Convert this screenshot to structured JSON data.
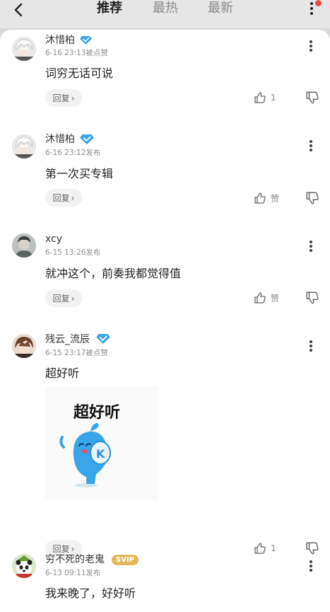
{
  "header": {
    "tabs": [
      {
        "label": "推荐",
        "active": true
      },
      {
        "label": "最热",
        "active": false
      },
      {
        "label": "最新",
        "active": false
      }
    ]
  },
  "colors": {
    "verified_badge": "#39a6f0",
    "svip_badge": "#e2b85a",
    "notification_dot": "#f04a4a"
  },
  "comments": [
    {
      "username": "沐惜柏",
      "username_partially_visible": true,
      "verified": true,
      "meta": "6-16 23:13被点赞",
      "content": "词穷无话可说",
      "reply_label": "回复",
      "like_label": "1",
      "avatar": "avatar-anime-white-hair"
    },
    {
      "username": "沐惜柏",
      "verified": true,
      "meta": "6-16 23:12发布",
      "content": "第一次买专辑",
      "reply_label": "回复",
      "like_label": "赞",
      "avatar": "avatar-anime-white-hair"
    },
    {
      "username": "xcy",
      "verified": false,
      "meta": "6-15 13:26发布",
      "content": "就冲这个，前奏我都觉得值",
      "reply_label": "回复",
      "like_label": "赞",
      "avatar": "avatar-portrait"
    },
    {
      "username": "残云_流辰",
      "verified": true,
      "meta": "6-15 23:17被点赞",
      "content": "超好听",
      "sticker_text": "超好听",
      "sticker_logo_letter": "K",
      "reply_label": "回复",
      "like_label": "1",
      "avatar": "avatar-anime-brown-hair"
    },
    {
      "username": "穷不死的老鬼",
      "verified": false,
      "svip": "SVIP",
      "meta": "6-13 09:11发布",
      "content": "我来晚了，好好听",
      "avatar": "avatar-panda"
    }
  ]
}
